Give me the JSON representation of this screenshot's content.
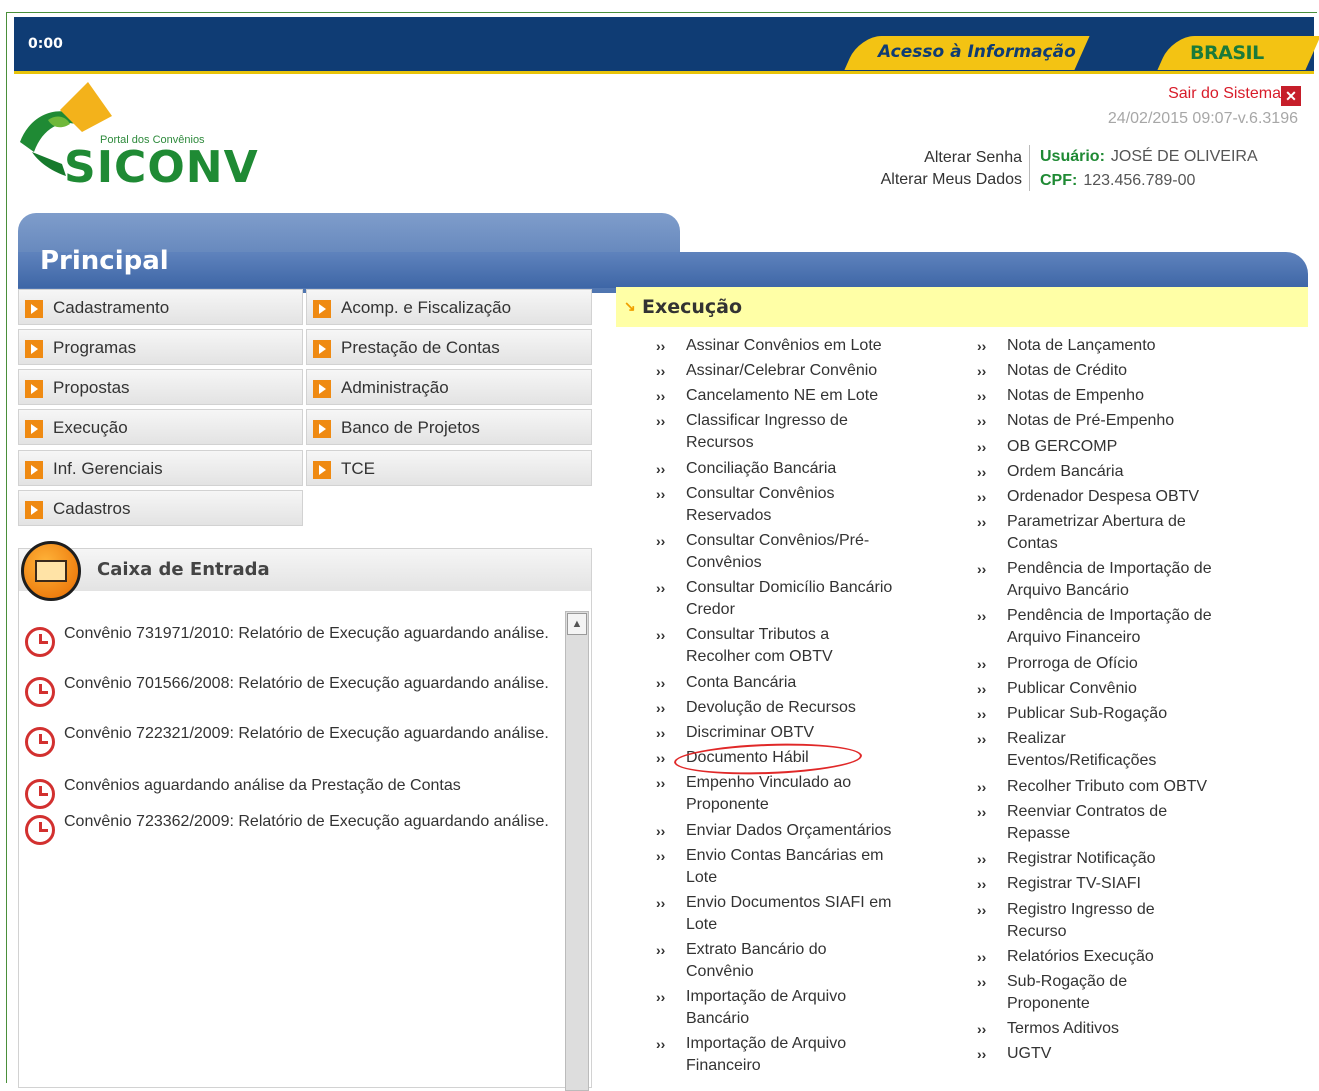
{
  "topbar": {
    "timer": "0:00",
    "acesso_label": "Acesso à Informação",
    "brasil_label": "BRASIL"
  },
  "logo": {
    "subtitle": "Portal dos Convênios",
    "title": "SICONV"
  },
  "header": {
    "logout_label": "Sair do Sistema",
    "version": "24/02/2015 09:07-v.6.3196",
    "change_password": "Alterar Senha",
    "change_data": "Alterar Meus Dados",
    "user_label": "Usuário:",
    "user_name": "JOSÉ DE OLIVEIRA",
    "cpf_label": "CPF:",
    "cpf_value": "123.456.789-00"
  },
  "principal": {
    "title": "Principal"
  },
  "menu": {
    "left": [
      "Cadastramento",
      "Programas",
      "Propostas",
      "Execução",
      "Inf. Gerenciais",
      "Cadastros"
    ],
    "right": [
      "Acomp. e Fiscalização",
      "Prestação de Contas",
      "Administração",
      "Banco de Projetos",
      "TCE"
    ]
  },
  "inbox": {
    "title": "Caixa de Entrada",
    "messages": [
      "Convênio 731971/2010: Relatório de Execução aguardando análise.",
      "Convênio 701566/2008: Relatório de Execução aguardando análise.",
      "Convênio 722321/2009: Relatório de Execução aguardando análise.",
      "Convênios aguardando análise da Prestação de Contas",
      "Convênio 723362/2009: Relatório de Execução aguardando análise."
    ]
  },
  "execucao": {
    "title": "Execução",
    "bullet": "››",
    "col1": [
      "Assinar Convênios em Lote",
      "Assinar/Celebrar Convênio",
      "Cancelamento NE em Lote",
      "Classificar Ingresso de Recursos",
      "Conciliação Bancária",
      "Consultar Convênios Reservados",
      "Consultar Convênios/Pré-Convênios",
      "Consultar Domicílio Bancário Credor",
      "Consultar Tributos a Recolher com OBTV",
      "Conta Bancária",
      "Devolução de Recursos",
      "Discriminar OBTV",
      "Documento Hábil",
      "Empenho Vinculado ao Proponente",
      "Enviar Dados Orçamentários",
      "Envio Contas Bancárias em Lote",
      "Envio Documentos SIAFI em Lote",
      "Extrato Bancário do Convênio",
      "Importação de Arquivo Bancário",
      "Importação de Arquivo Financeiro"
    ],
    "col2": [
      "Nota de Lançamento",
      "Notas de Crédito",
      "Notas de Empenho",
      "Notas de Pré-Empenho",
      "OB GERCOMP",
      "Ordem Bancária",
      "Ordenador Despesa OBTV",
      "Parametrizar Abertura de Contas",
      "Pendência de Importação de Arquivo Bancário",
      "Pendência de Importação de Arquivo Financeiro",
      "Prorroga de Ofício",
      "Publicar Convênio",
      "Publicar Sub-Rogação",
      "Realizar Eventos/Retificações",
      "Recolher Tributo com OBTV",
      "Reenviar Contratos de Repasse",
      "Registrar Notificação",
      "Registrar TV-SIAFI",
      "Registro Ingresso de Recurso",
      "Relatórios Execução",
      "Sub-Rogação de Proponente",
      "Termos Aditivos",
      "UGTV"
    ]
  },
  "colors": {
    "topbar": "#0f3c74",
    "accent_yellow": "#f3c313",
    "brand_green": "#1f8a34",
    "principal_blue": "#4f75b0",
    "section_yellow": "#ffffa6",
    "logout_red": "#d81c2a"
  }
}
